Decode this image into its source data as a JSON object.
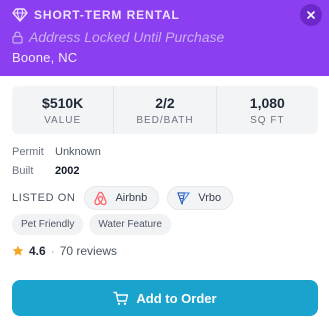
{
  "header": {
    "property_type": "SHORT-TERM RENTAL",
    "address_text": "Address Locked Until Purchase",
    "location": "Boone, NC",
    "background_color": "#8b3ff0"
  },
  "stats": [
    {
      "value": "$510K",
      "label": "VALUE"
    },
    {
      "value": "2/2",
      "label": "BED/BATH"
    },
    {
      "value": "1,080",
      "label": "SQ FT"
    }
  ],
  "details": {
    "permit": {
      "label": "Permit",
      "value": "Unknown"
    },
    "built": {
      "label": "Built",
      "value": "2002"
    }
  },
  "listed_on": {
    "label": "LISTED ON",
    "platforms": [
      {
        "name": "Airbnb",
        "icon": "airbnb-icon",
        "color": "#ff5a5f"
      },
      {
        "name": "Vrbo",
        "icon": "vrbo-icon",
        "color": "#245abc"
      }
    ]
  },
  "tags": [
    "Pet Friendly",
    "Water Feature"
  ],
  "rating": {
    "value": "4.6",
    "separator": "·",
    "count_text": "70 reviews",
    "star_color": "#f5a623"
  },
  "cta": {
    "label": "Add to Order",
    "icon": "cart-icon",
    "color": "#1aa3cc"
  }
}
